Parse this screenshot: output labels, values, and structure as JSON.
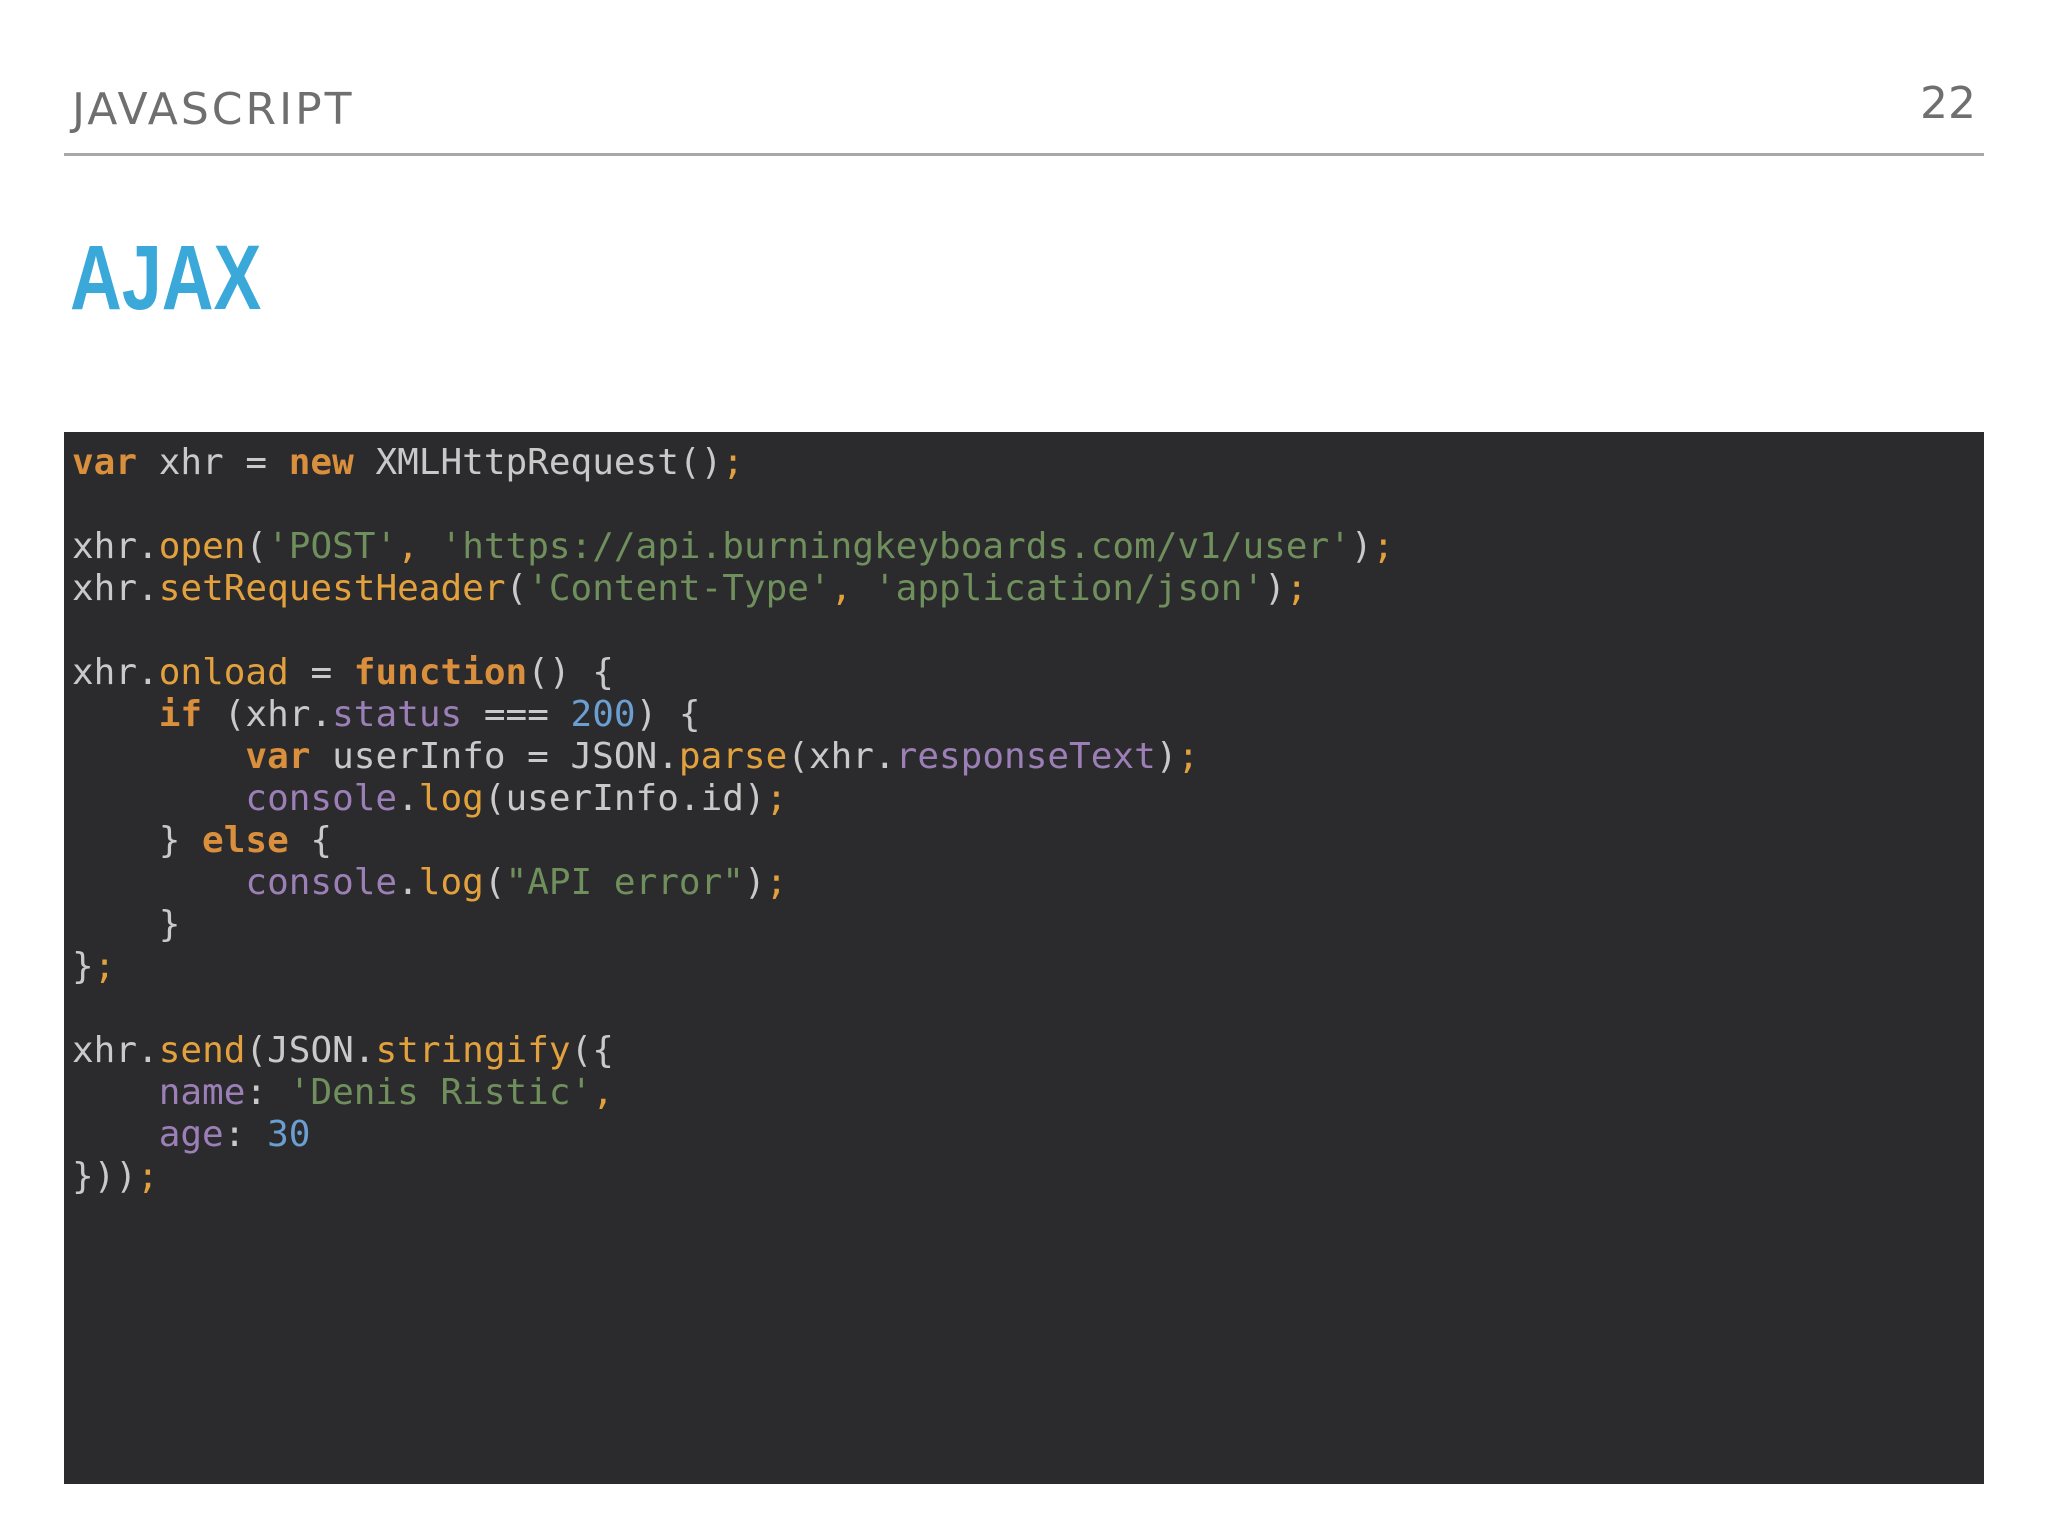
{
  "header": {
    "section_label": "JAVASCRIPT",
    "page_number": "22"
  },
  "slide": {
    "title": "AJAX"
  },
  "colors": {
    "title": "#3aa8d8",
    "header_text": "#6f6f6f",
    "code_background": "#2b2b2d",
    "keyword": "#d98f3c",
    "function": "#e3a13d",
    "string": "#6f8f5c",
    "number": "#6b9fd2",
    "property": "#9b7fb6",
    "plain": "#c9c9c9"
  },
  "code": {
    "language": "JavaScript",
    "lines": [
      [
        {
          "t": "var",
          "c": "kw"
        },
        {
          "t": " xhr = ",
          "c": "plain"
        },
        {
          "t": "new",
          "c": "kw"
        },
        {
          "t": " XMLHttpRequest()",
          "c": "plain"
        },
        {
          "t": ";",
          "c": "punct"
        }
      ],
      [],
      [
        {
          "t": "xhr",
          "c": "plain"
        },
        {
          "t": ".",
          "c": "plain"
        },
        {
          "t": "open",
          "c": "fn"
        },
        {
          "t": "(",
          "c": "plain"
        },
        {
          "t": "'POST'",
          "c": "str"
        },
        {
          "t": ", ",
          "c": "punct"
        },
        {
          "t": "'https://api.burningkeyboards.com/v1/user'",
          "c": "str"
        },
        {
          "t": ")",
          "c": "plain"
        },
        {
          "t": ";",
          "c": "punct"
        }
      ],
      [
        {
          "t": "xhr",
          "c": "plain"
        },
        {
          "t": ".",
          "c": "plain"
        },
        {
          "t": "setRequestHeader",
          "c": "fn"
        },
        {
          "t": "(",
          "c": "plain"
        },
        {
          "t": "'Content-Type'",
          "c": "str"
        },
        {
          "t": ", ",
          "c": "punct"
        },
        {
          "t": "'application/json'",
          "c": "str"
        },
        {
          "t": ")",
          "c": "plain"
        },
        {
          "t": ";",
          "c": "punct"
        }
      ],
      [],
      [
        {
          "t": "xhr",
          "c": "plain"
        },
        {
          "t": ".",
          "c": "plain"
        },
        {
          "t": "onload",
          "c": "fn"
        },
        {
          "t": " = ",
          "c": "plain"
        },
        {
          "t": "function",
          "c": "kw"
        },
        {
          "t": "() {",
          "c": "plain"
        }
      ],
      [
        {
          "t": "    ",
          "c": "plain"
        },
        {
          "t": "if",
          "c": "kw"
        },
        {
          "t": " (xhr",
          "c": "plain"
        },
        {
          "t": ".",
          "c": "plain"
        },
        {
          "t": "status",
          "c": "prop"
        },
        {
          "t": " === ",
          "c": "plain"
        },
        {
          "t": "200",
          "c": "num"
        },
        {
          "t": ") {",
          "c": "plain"
        }
      ],
      [
        {
          "t": "        ",
          "c": "plain"
        },
        {
          "t": "var",
          "c": "kw"
        },
        {
          "t": " userInfo = JSON",
          "c": "plain"
        },
        {
          "t": ".",
          "c": "plain"
        },
        {
          "t": "parse",
          "c": "fn"
        },
        {
          "t": "(xhr",
          "c": "plain"
        },
        {
          "t": ".",
          "c": "plain"
        },
        {
          "t": "responseText",
          "c": "prop"
        },
        {
          "t": ")",
          "c": "plain"
        },
        {
          "t": ";",
          "c": "punct"
        }
      ],
      [
        {
          "t": "        ",
          "c": "plain"
        },
        {
          "t": "console",
          "c": "prop"
        },
        {
          "t": ".",
          "c": "plain"
        },
        {
          "t": "log",
          "c": "fn"
        },
        {
          "t": "(userInfo.id)",
          "c": "plain"
        },
        {
          "t": ";",
          "c": "punct"
        }
      ],
      [
        {
          "t": "    } ",
          "c": "plain"
        },
        {
          "t": "else",
          "c": "kw"
        },
        {
          "t": " {",
          "c": "plain"
        }
      ],
      [
        {
          "t": "        ",
          "c": "plain"
        },
        {
          "t": "console",
          "c": "prop"
        },
        {
          "t": ".",
          "c": "plain"
        },
        {
          "t": "log",
          "c": "fn"
        },
        {
          "t": "(",
          "c": "plain"
        },
        {
          "t": "\"API error\"",
          "c": "str"
        },
        {
          "t": ")",
          "c": "plain"
        },
        {
          "t": ";",
          "c": "punct"
        }
      ],
      [
        {
          "t": "    }",
          "c": "plain"
        }
      ],
      [
        {
          "t": "}",
          "c": "plain"
        },
        {
          "t": ";",
          "c": "punct"
        }
      ],
      [],
      [
        {
          "t": "xhr",
          "c": "plain"
        },
        {
          "t": ".",
          "c": "plain"
        },
        {
          "t": "send",
          "c": "fn"
        },
        {
          "t": "(JSON",
          "c": "plain"
        },
        {
          "t": ".",
          "c": "plain"
        },
        {
          "t": "stringify",
          "c": "fn"
        },
        {
          "t": "({",
          "c": "plain"
        }
      ],
      [
        {
          "t": "    ",
          "c": "plain"
        },
        {
          "t": "name",
          "c": "prop"
        },
        {
          "t": ": ",
          "c": "plain"
        },
        {
          "t": "'Denis Ristic'",
          "c": "str"
        },
        {
          "t": ",",
          "c": "punct"
        }
      ],
      [
        {
          "t": "    ",
          "c": "plain"
        },
        {
          "t": "age",
          "c": "prop"
        },
        {
          "t": ": ",
          "c": "plain"
        },
        {
          "t": "30",
          "c": "num"
        }
      ],
      [
        {
          "t": "}))",
          "c": "plain"
        },
        {
          "t": ";",
          "c": "punct"
        }
      ]
    ]
  }
}
